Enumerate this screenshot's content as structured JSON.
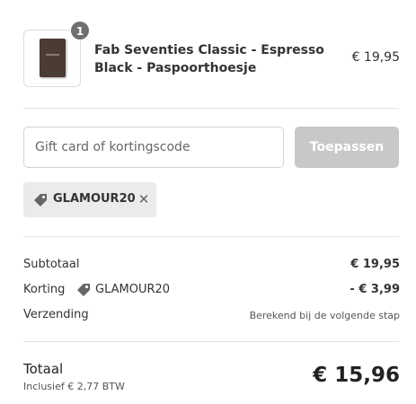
{
  "product": {
    "quantity": "1",
    "name": "Fab Seventies Classic - Espresso Black - Paspoorthoesje",
    "price": "€ 19,95"
  },
  "discount": {
    "placeholder": "Gift card of kortingscode",
    "apply_label": "Toepassen",
    "applied_code": "GLAMOUR20",
    "remove_glyph": "✕"
  },
  "summary": {
    "subtotal_label": "Subtotaal",
    "subtotal_value": "€ 19,95",
    "discount_label": "Korting",
    "discount_code": "GLAMOUR20",
    "discount_value": "- € 3,99",
    "shipping_label": "Verzending",
    "shipping_value": "Berekend bij de volgende stap"
  },
  "total": {
    "label": "Totaal",
    "tax_note": "Inclusief € 2,77 BTW",
    "value": "€ 15,96"
  },
  "icons": {
    "tag": "tag-icon",
    "remove": "close-icon"
  },
  "colors": {
    "button_disabled": "#c8c8c8",
    "chip_bg": "#ebebeb",
    "badge_bg": "#6f6f6f"
  }
}
